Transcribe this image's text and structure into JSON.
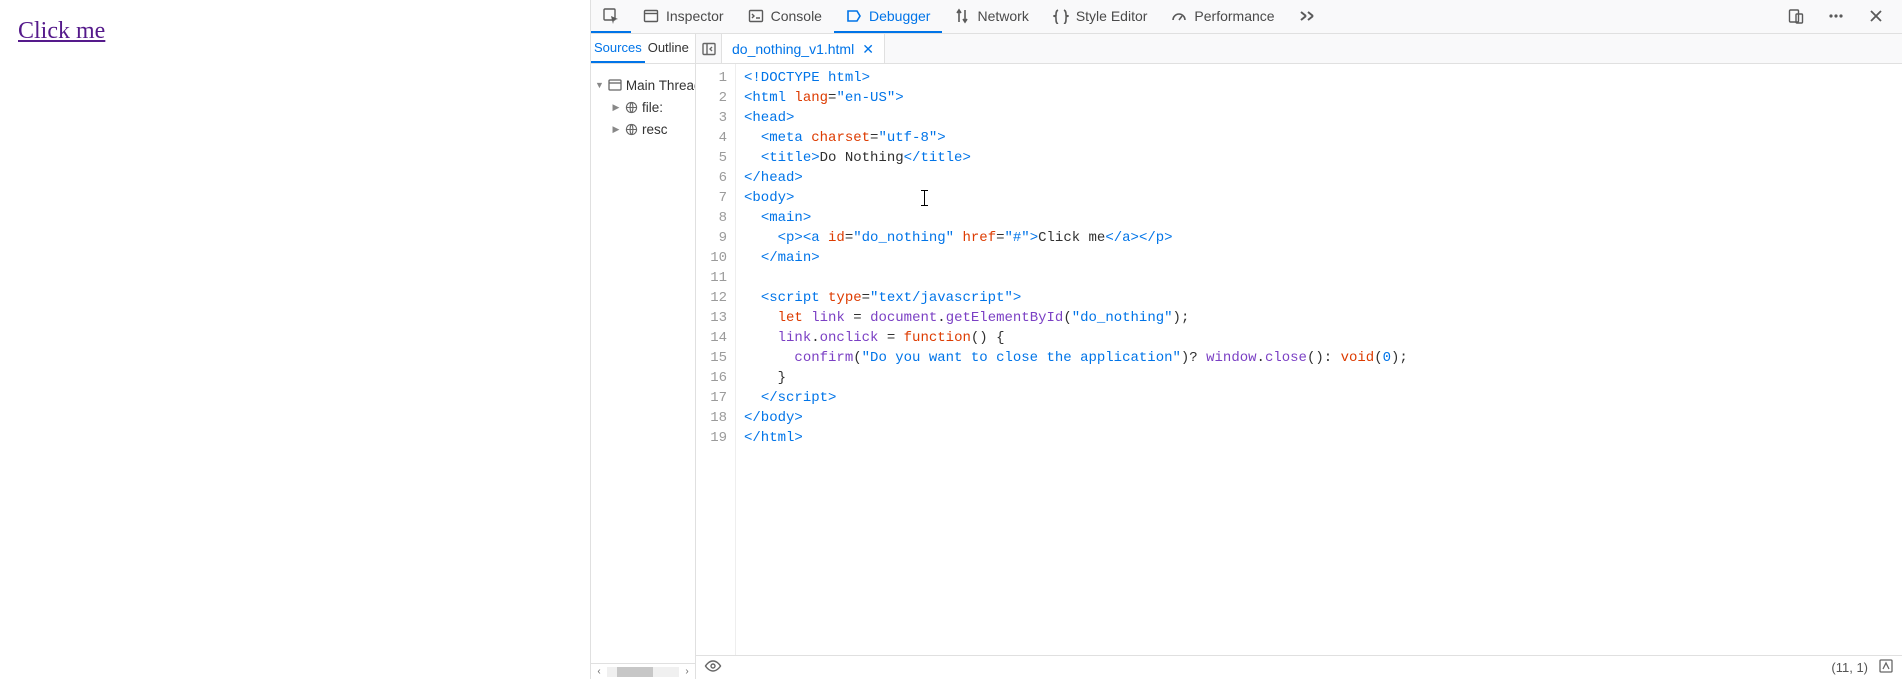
{
  "page": {
    "link_text": "Click me"
  },
  "toolbar": {
    "inspector": "Inspector",
    "console": "Console",
    "debugger": "Debugger",
    "network": "Network",
    "style_editor": "Style Editor",
    "performance": "Performance"
  },
  "sources": {
    "tab_sources": "Sources",
    "tab_outline": "Outline",
    "tree": {
      "root": "Main Thread",
      "items": [
        "file:",
        "resc"
      ]
    }
  },
  "open_file": {
    "name": "do_nothing_v1.html"
  },
  "code": {
    "lines": [
      [
        [
          "tag",
          "<!DOCTYPE html>"
        ]
      ],
      [
        [
          "tag",
          "<html "
        ],
        [
          "attr",
          "lang"
        ],
        [
          "txt",
          "="
        ],
        [
          "str",
          "\"en-US\""
        ],
        [
          "tag",
          ">"
        ]
      ],
      [
        [
          "tag",
          "<head>"
        ]
      ],
      [
        [
          "txt",
          "  "
        ],
        [
          "tag",
          "<meta "
        ],
        [
          "attr",
          "charset"
        ],
        [
          "txt",
          "="
        ],
        [
          "str",
          "\"utf-8\""
        ],
        [
          "tag",
          ">"
        ]
      ],
      [
        [
          "txt",
          "  "
        ],
        [
          "tag",
          "<title>"
        ],
        [
          "txt",
          "Do Nothing"
        ],
        [
          "tag",
          "</title>"
        ]
      ],
      [
        [
          "tag",
          "</head>"
        ]
      ],
      [
        [
          "tag",
          "<body>"
        ]
      ],
      [
        [
          "txt",
          "  "
        ],
        [
          "tag",
          "<main>"
        ]
      ],
      [
        [
          "txt",
          "    "
        ],
        [
          "tag",
          "<p><a "
        ],
        [
          "attr",
          "id"
        ],
        [
          "txt",
          "="
        ],
        [
          "str",
          "\"do_nothing\""
        ],
        [
          "txt",
          " "
        ],
        [
          "attr",
          "href"
        ],
        [
          "txt",
          "="
        ],
        [
          "str",
          "\"#\""
        ],
        [
          "tag",
          ">"
        ],
        [
          "txt",
          "Click me"
        ],
        [
          "tag",
          "</a></p>"
        ]
      ],
      [
        [
          "txt",
          "  "
        ],
        [
          "tag",
          "</main>"
        ]
      ],
      [
        [
          "txt",
          ""
        ]
      ],
      [
        [
          "txt",
          "  "
        ],
        [
          "tag",
          "<script "
        ],
        [
          "attr",
          "type"
        ],
        [
          "txt",
          "="
        ],
        [
          "str",
          "\"text/javascript\""
        ],
        [
          "tag",
          ">"
        ]
      ],
      [
        [
          "txt",
          "    "
        ],
        [
          "kw",
          "let"
        ],
        [
          "txt",
          " "
        ],
        [
          "var",
          "link"
        ],
        [
          "txt",
          " = "
        ],
        [
          "var",
          "document"
        ],
        [
          "txt",
          "."
        ],
        [
          "fn",
          "getElementById"
        ],
        [
          "txt",
          "("
        ],
        [
          "str",
          "\"do_nothing\""
        ],
        [
          "txt",
          ");"
        ]
      ],
      [
        [
          "txt",
          "    "
        ],
        [
          "var",
          "link"
        ],
        [
          "txt",
          "."
        ],
        [
          "var",
          "onclick"
        ],
        [
          "txt",
          " = "
        ],
        [
          "kw",
          "function"
        ],
        [
          "txt",
          "() {"
        ]
      ],
      [
        [
          "txt",
          "      "
        ],
        [
          "fn",
          "confirm"
        ],
        [
          "txt",
          "("
        ],
        [
          "str",
          "\"Do you want to close the application\""
        ],
        [
          "txt",
          ")? "
        ],
        [
          "var",
          "window"
        ],
        [
          "txt",
          "."
        ],
        [
          "fn",
          "close"
        ],
        [
          "txt",
          "(): "
        ],
        [
          "kw",
          "void"
        ],
        [
          "txt",
          "("
        ],
        [
          "num",
          "0"
        ],
        [
          "txt",
          ");"
        ]
      ],
      [
        [
          "txt",
          "    }"
        ]
      ],
      [
        [
          "txt",
          "  "
        ],
        [
          "tag",
          "</"
        ],
        [
          "tag",
          "script"
        ],
        [
          "tag",
          ">"
        ]
      ],
      [
        [
          "tag",
          "</body>"
        ]
      ],
      [
        [
          "tag",
          "</html>"
        ]
      ]
    ]
  },
  "status": {
    "cursor": "(11, 1)"
  }
}
